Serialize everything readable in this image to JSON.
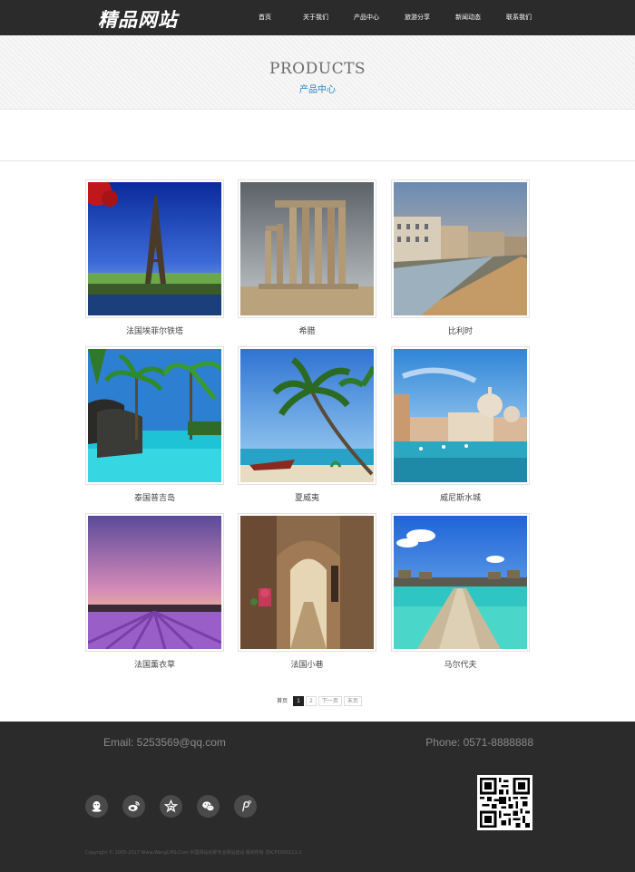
{
  "header": {
    "logo": "精品网站",
    "nav": [
      "首页",
      "关于我们",
      "产品中心",
      "旅游分享",
      "新闻动态",
      "联系我们"
    ]
  },
  "banner": {
    "title_en": "PRODUCTS",
    "title_cn": "产品中心"
  },
  "products": [
    {
      "name": "法国埃菲尔铁塔",
      "scene": "eiffel"
    },
    {
      "name": "希腊",
      "scene": "temple"
    },
    {
      "name": "比利时",
      "scene": "canal"
    },
    {
      "name": "泰国普吉岛",
      "scene": "pool"
    },
    {
      "name": "夏威夷",
      "scene": "beach"
    },
    {
      "name": "威尼斯水城",
      "scene": "venice"
    },
    {
      "name": "法国薰衣草",
      "scene": "lavender"
    },
    {
      "name": "法国小巷",
      "scene": "alley"
    },
    {
      "name": "马尔代夫",
      "scene": "maldives"
    }
  ],
  "pagination": {
    "first": "首页",
    "pages": [
      "1",
      "2"
    ],
    "current": "1",
    "next": "下一页",
    "last": "末页"
  },
  "footer": {
    "email": "Email: 5253569@qq.com",
    "phone": "Phone: 0571-8888888",
    "social": [
      "qq-icon",
      "weibo-icon",
      "star-icon",
      "wechat-icon",
      "pinterest-icon"
    ],
    "copyright": "Copyright © 2005-2017 Www.WangCMS.Com 中国网站名称专业网站建设 版权所有 苏ICP5056111-1"
  },
  "colors": {
    "header_bg": "#2b2b2b",
    "accent_blue": "#2a86c4",
    "footer_bg": "#2b2b2b"
  }
}
